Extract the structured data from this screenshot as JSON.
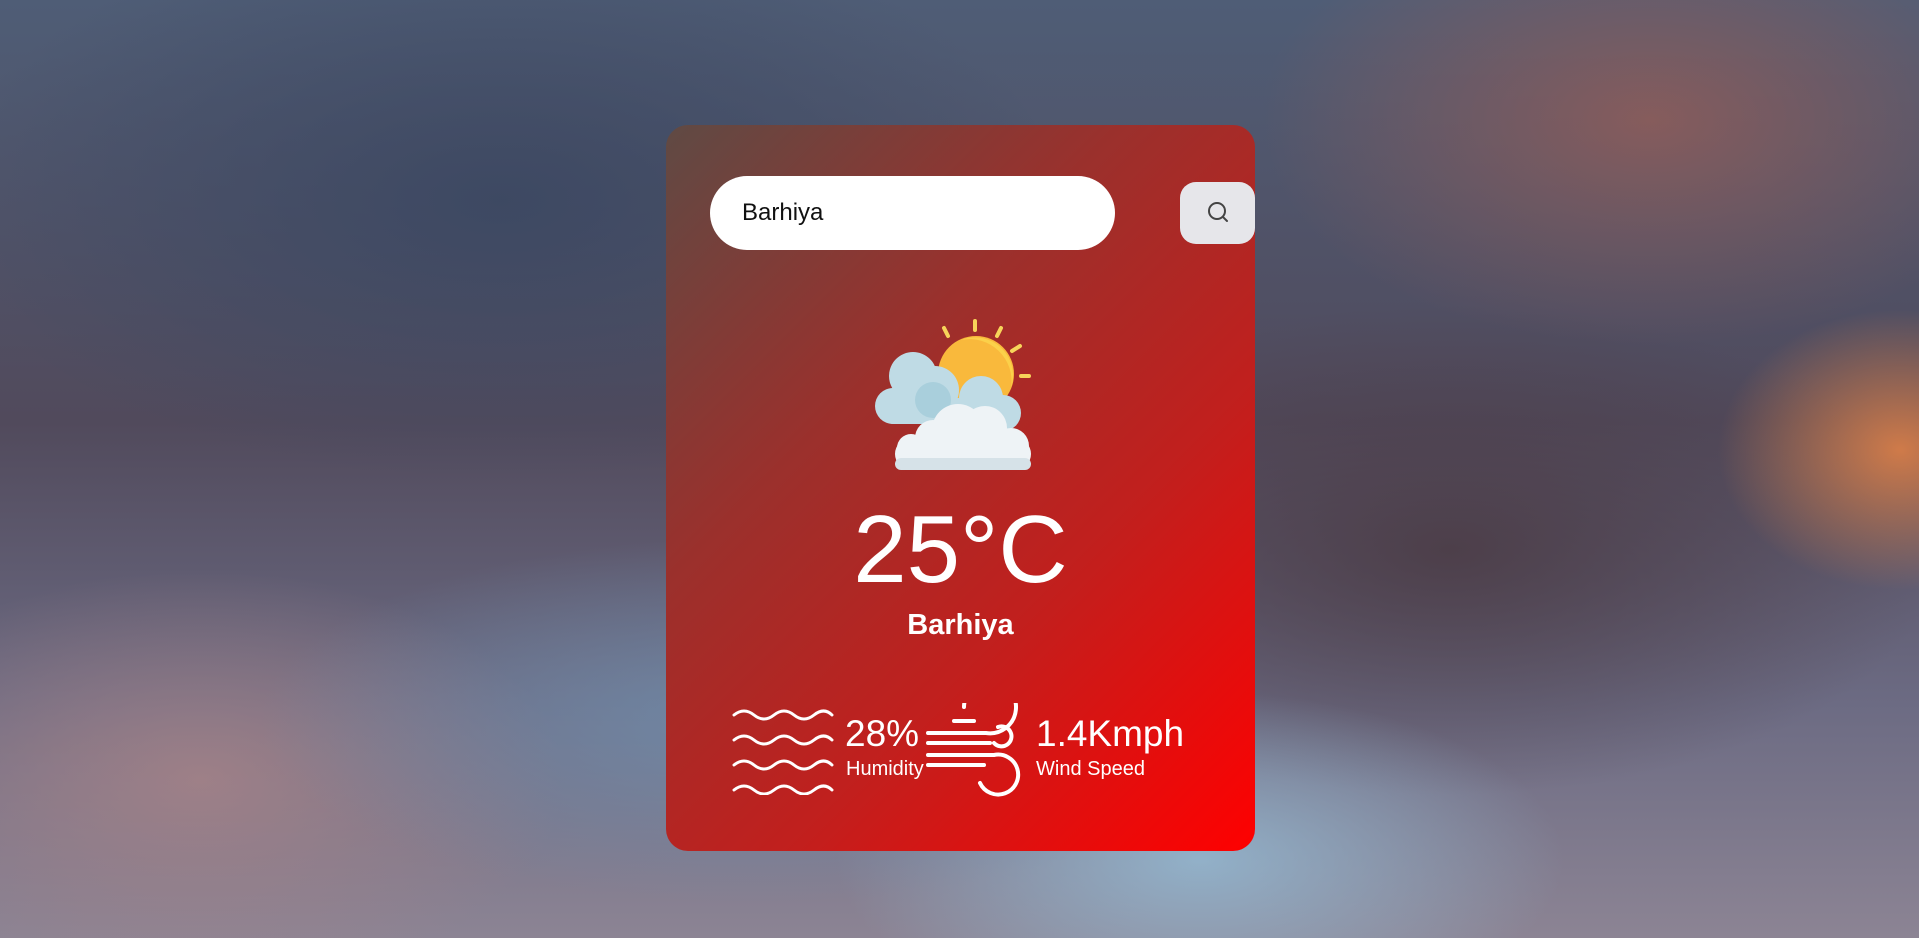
{
  "search": {
    "value": "Barhiya",
    "button_icon": "search-icon"
  },
  "weather": {
    "condition_icon": "partly-cloudy-icon",
    "temperature": "25°C",
    "city": "Barhiya"
  },
  "humidity": {
    "icon": "humidity-waves-icon",
    "value": "28%",
    "label": "Humidity"
  },
  "wind": {
    "icon": "wind-icon",
    "value": "1.4Kmph",
    "label": "Wind Speed"
  },
  "colors": {
    "card_gradient_start": "#5f4a44",
    "card_gradient_end": "#ff0000",
    "search_button_bg": "#e6e6ea",
    "sun": "#f9c23c",
    "cloud": "#eef3f6"
  }
}
